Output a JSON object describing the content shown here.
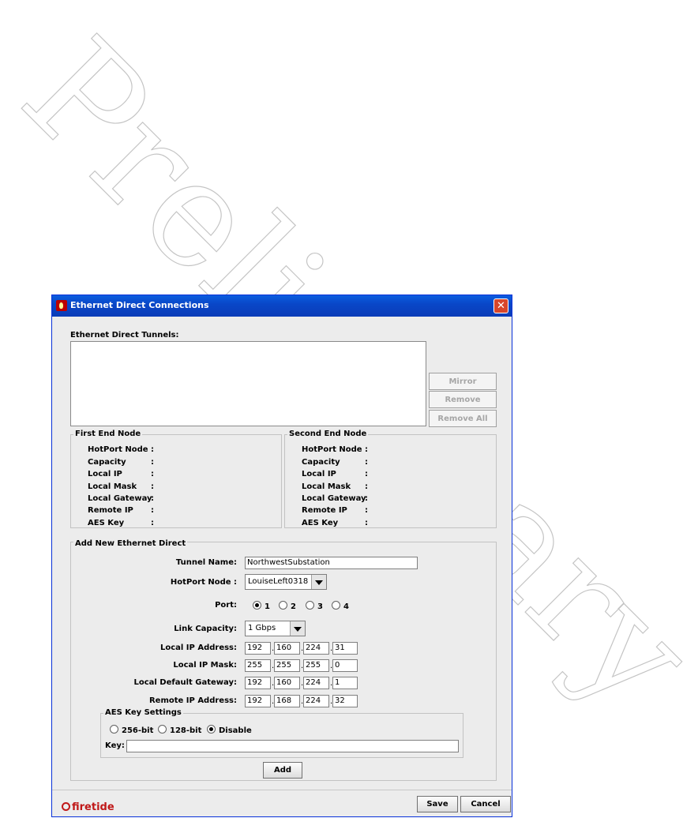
{
  "watermark": "Preliminary",
  "window": {
    "title": "Ethernet Direct Connections",
    "close_glyph": "✕"
  },
  "tunnels": {
    "label": "Ethernet Direct Tunnels:",
    "mirror_label": "Mirror",
    "remove_label": "Remove",
    "remove_all_label": "Remove All"
  },
  "first_end": {
    "title": "First End Node",
    "rows": [
      "HotPort Node",
      "Capacity",
      "Local IP",
      "Local Mask",
      "Local Gateway",
      "Remote IP",
      "AES Key"
    ]
  },
  "second_end": {
    "title": "Second End Node",
    "rows": [
      "HotPort Node",
      "Capacity",
      "Local IP",
      "Local Mask",
      "Local Gateway",
      "Remote IP",
      "AES Key"
    ]
  },
  "add": {
    "title": "Add New Ethernet Direct",
    "tunnel_name_label": "Tunnel Name:",
    "tunnel_name_value": "NorthwestSubstation",
    "hotport_label": "HotPort Node :",
    "hotport_value": "LouiseLeft0318",
    "port_label": "Port:",
    "ports": [
      "1",
      "2",
      "3",
      "4"
    ],
    "port_selected": "1",
    "link_capacity_label": "Link Capacity:",
    "link_capacity_value": "1 Gbps",
    "local_ip_label": "Local IP Address:",
    "local_ip": [
      "192",
      "160",
      "224",
      "31"
    ],
    "local_mask_label": "Local IP Mask:",
    "local_mask": [
      "255",
      "255",
      "255",
      "0"
    ],
    "gateway_label": "Local Default Gateway:",
    "gateway": [
      "192",
      "160",
      "224",
      "1"
    ],
    "remote_ip_label": "Remote IP Address:",
    "remote_ip": [
      "192",
      "168",
      "224",
      "32"
    ],
    "aes": {
      "title": "AES Key Settings",
      "options": [
        "256-bit",
        "128-bit",
        "Disable"
      ],
      "selected": "Disable",
      "key_label": "Key:",
      "key_value": ""
    },
    "add_label": "Add"
  },
  "footer": {
    "brand": "firetide",
    "save_label": "Save",
    "cancel_label": "Cancel"
  }
}
